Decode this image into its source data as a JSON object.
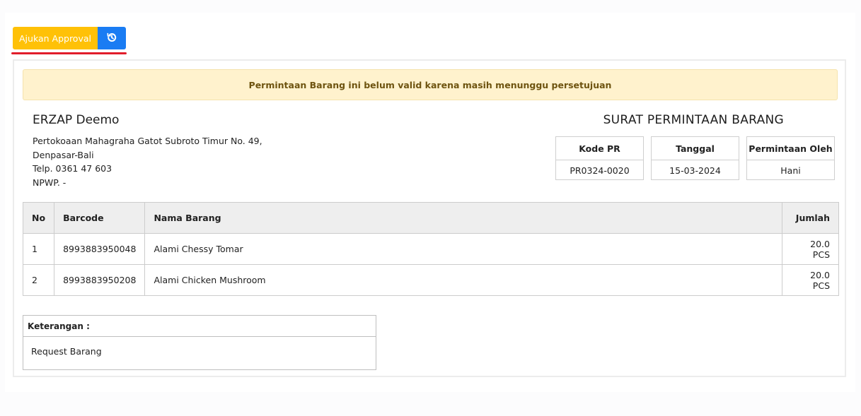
{
  "toolbar": {
    "approval_label": "Ajukan Approval",
    "history_icon": "history-icon",
    "colors": {
      "approval": "#ffc107",
      "history": "#1a7cf3",
      "highlight": "#e11d2b"
    }
  },
  "alert": {
    "message": "Permintaan Barang ini belum valid karena masih menunggu persetujuan"
  },
  "company": {
    "name": "ERZAP Deemo",
    "address_line1": "Pertokoaan Mahagraha Gatot Subroto Timur No. 49,",
    "address_line2": "Denpasar-Bali",
    "phone": "Telp. 0361 47 603",
    "npwp": "NPWP. -"
  },
  "document": {
    "title": "SURAT PERMINTAAN BARANG",
    "meta": [
      {
        "label": "Kode PR",
        "value": "PR0324-0020"
      },
      {
        "label": "Tanggal",
        "value": "15-03-2024"
      },
      {
        "label": "Permintaan Oleh",
        "value": "Hani"
      }
    ]
  },
  "table": {
    "headers": [
      "No",
      "Barcode",
      "Nama Barang",
      "Jumlah"
    ],
    "rows": [
      {
        "no": "1",
        "barcode": "8993883950048",
        "name": "Alami Chessy Tomar",
        "qty": "20.0 PCS"
      },
      {
        "no": "2",
        "barcode": "8993883950208",
        "name": "Alami Chicken Mushroom",
        "qty": "20.0 PCS"
      }
    ]
  },
  "note": {
    "label": "Keterangan :",
    "text": "Request Barang"
  }
}
